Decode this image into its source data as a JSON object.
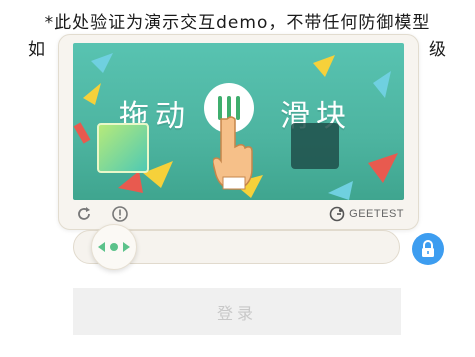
{
  "notice": {
    "line1": "*此处验证为演示交互demo，不带任何防御模型",
    "line2_left": "如",
    "line2_right": "级"
  },
  "captcha": {
    "hint_left": "拖动",
    "hint_right": "滑块",
    "brand": "GEETEST",
    "icons": {
      "refresh": "refresh-icon",
      "info": "info-icon",
      "brand_logo": "geetest-logo-icon",
      "hand": "hand-pointer-icon"
    }
  },
  "slider": {
    "thumb_icon": "drag-arrows-icon",
    "lock_icon": "lock-icon"
  },
  "login": {
    "label": "登录"
  },
  "colors": {
    "accent_blue": "#3d9df0",
    "thumb_green": "#3fae6e",
    "puzzle_bg": "#58c3b1"
  }
}
